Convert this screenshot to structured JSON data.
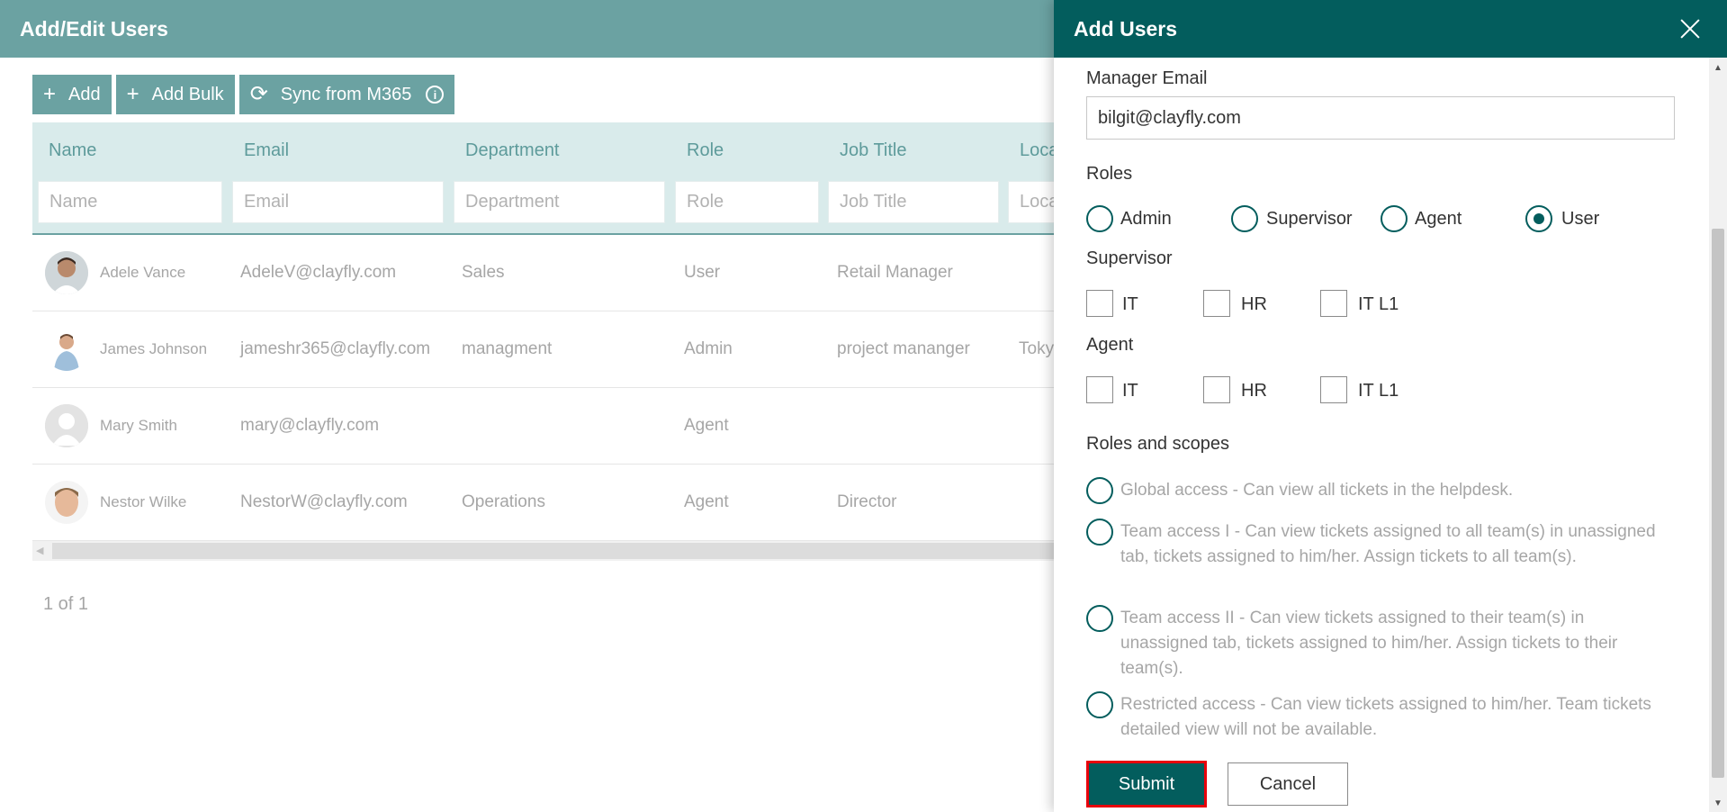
{
  "page": {
    "title": "Add/Edit Users",
    "toolbar": {
      "add": "Add",
      "add_bulk": "Add Bulk",
      "sync": "Sync from M365"
    },
    "columns": [
      {
        "header": "Name",
        "filter_placeholder": "Name"
      },
      {
        "header": "Email",
        "filter_placeholder": "Email"
      },
      {
        "header": "Department",
        "filter_placeholder": "Department"
      },
      {
        "header": "Role",
        "filter_placeholder": "Role"
      },
      {
        "header": "Job Title",
        "filter_placeholder": "Job Title"
      },
      {
        "header": "Loca",
        "filter_placeholder": "Loca"
      }
    ],
    "rows": [
      {
        "name": "Adele Vance",
        "email": "AdeleV@clayfly.com",
        "department": "Sales",
        "role": "User",
        "job_title": "Retail Manager",
        "location": ""
      },
      {
        "name": "James Johnson",
        "email": "jameshr365@clayfly.com",
        "department": "managment",
        "role": "Admin",
        "job_title": "project mananger",
        "location": "Toky"
      },
      {
        "name": "Mary Smith",
        "email": "mary@clayfly.com",
        "department": "",
        "role": "Agent",
        "job_title": "",
        "location": ""
      },
      {
        "name": "Nestor Wilke",
        "email": "NestorW@clayfly.com",
        "department": "Operations",
        "role": "Agent",
        "job_title": "Director",
        "location": ""
      }
    ],
    "pager": "1 of 1"
  },
  "panel": {
    "title": "Add Users",
    "manager_email_label": "Manager Email",
    "manager_email_value": "bilgit@clayfly.com",
    "roles_label": "Roles",
    "roles": [
      {
        "label": "Admin",
        "selected": false
      },
      {
        "label": "Supervisor",
        "selected": false
      },
      {
        "label": "Agent",
        "selected": false
      },
      {
        "label": "User",
        "selected": true
      }
    ],
    "supervisor_label": "Supervisor",
    "supervisor_options": [
      "IT",
      "HR",
      "IT L1"
    ],
    "agent_label": "Agent",
    "agent_options": [
      "IT",
      "HR",
      "IT L1"
    ],
    "scopes_label": "Roles and scopes",
    "scopes": [
      "Global access - Can view all tickets in the helpdesk.",
      "Team access I - Can view tickets assigned to all team(s) in unassigned tab, tickets assigned to him/her. Assign tickets to all team(s).",
      "Team access II - Can view tickets assigned to their team(s) in unassigned tab, tickets assigned to him/her. Assign tickets to their team(s).",
      "Restricted access - Can view tickets assigned to him/her. Team tickets detailed view will not be available."
    ],
    "submit": "Submit",
    "cancel": "Cancel"
  },
  "colors": {
    "header_teal": "#6ba2a2",
    "panel_teal": "#035d5d",
    "grid_header_bg": "#d9ebeb",
    "submit_border": "#e8000b"
  }
}
